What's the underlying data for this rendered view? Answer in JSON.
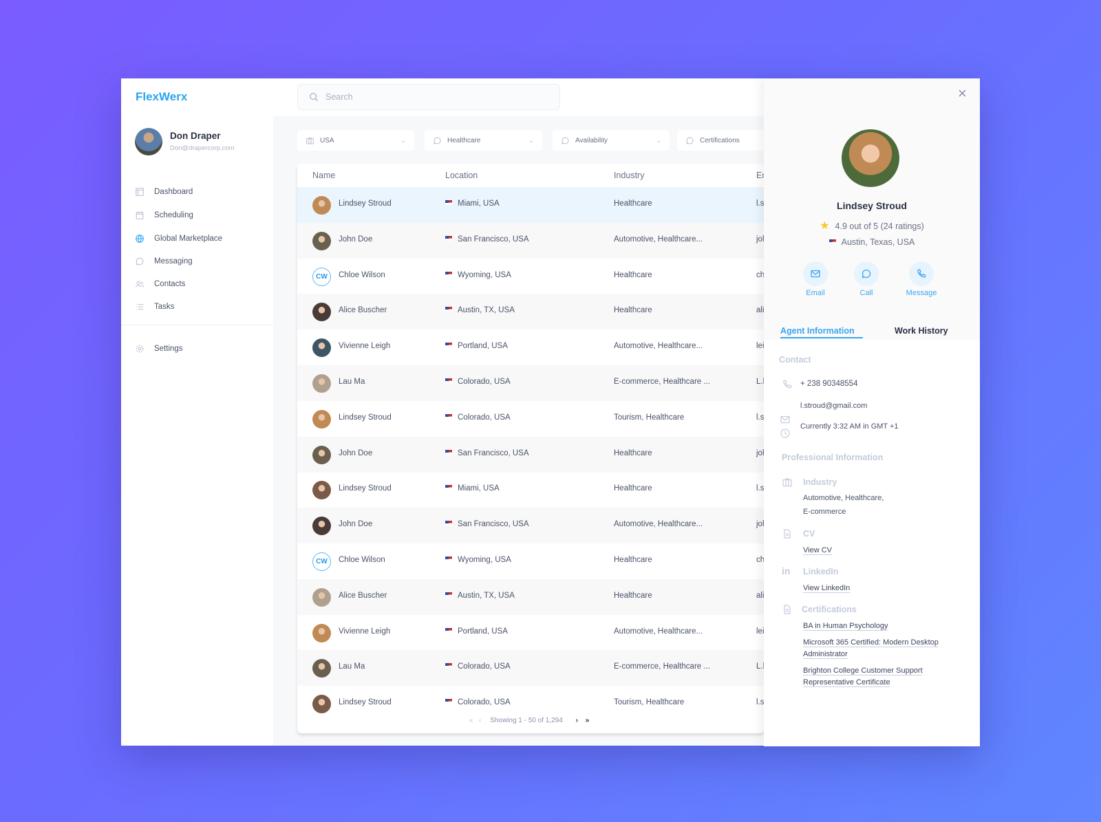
{
  "app": {
    "logo": "FlexWerx"
  },
  "user": {
    "name": "Don Draper",
    "email": "Don@drapercorp.com"
  },
  "sidebar": {
    "items": [
      {
        "label": "Dashboard",
        "icon": "dashboard-icon"
      },
      {
        "label": "Scheduling",
        "icon": "calendar-icon"
      },
      {
        "label": "Global Marketplace",
        "icon": "globe-icon"
      },
      {
        "label": "Messaging",
        "icon": "chat-icon"
      },
      {
        "label": "Contacts",
        "icon": "contacts-icon"
      },
      {
        "label": "Tasks",
        "icon": "list-icon"
      }
    ],
    "settings": "Settings",
    "active_color": "#2aa3f5"
  },
  "search": {
    "placeholder": "Search"
  },
  "filters": [
    "USA",
    "Healthcare",
    "Availability",
    "Certifications"
  ],
  "table": {
    "headers": [
      "Name",
      "Location",
      "Industry",
      "Er"
    ],
    "rows": [
      {
        "name": "Lindsey Stroud",
        "location": "Miami, USA",
        "industry": "Healthcare",
        "email": "l.s"
      },
      {
        "name": "John Doe",
        "location": "San Francisco, USA",
        "industry": "Automotive, Healthcare...",
        "email": "jol"
      },
      {
        "name": "Chloe Wilson",
        "initials": "CW",
        "location": "Wyoming, USA",
        "industry": "Healthcare",
        "email": "ch"
      },
      {
        "name": "Alice Buscher",
        "location": "Austin, TX, USA",
        "industry": "Healthcare",
        "email": "ali"
      },
      {
        "name": "Vivienne Leigh",
        "location": "Portland, USA",
        "industry": "Automotive, Healthcare...",
        "email": "lei"
      },
      {
        "name": "Lau Ma",
        "location": "Colorado, USA",
        "industry": "E-commerce, Healthcare  ...",
        "email": "L.l"
      },
      {
        "name": "Lindsey Stroud",
        "location": "Colorado, USA",
        "industry": "Tourism, Healthcare",
        "email": "l.s"
      },
      {
        "name": "John Doe",
        "location": "San Francisco, USA",
        "industry": "Healthcare",
        "email": "jol"
      },
      {
        "name": "Lindsey Stroud",
        "location": "Miami, USA",
        "industry": "Healthcare",
        "email": "l.s"
      },
      {
        "name": "John Doe",
        "location": "San Francisco, USA",
        "industry": "Automotive, Healthcare...",
        "email": "jol"
      },
      {
        "name": "Chloe Wilson",
        "initials": "CW",
        "location": "Wyoming, USA",
        "industry": "Healthcare",
        "email": "ch"
      },
      {
        "name": "Alice Buscher",
        "location": "Austin, TX, USA",
        "industry": "Healthcare",
        "email": "ali"
      },
      {
        "name": "Vivienne Leigh",
        "location": "Portland, USA",
        "industry": "Automotive, Healthcare...",
        "email": "lei"
      },
      {
        "name": "Lau Ma",
        "location": "Colorado, USA",
        "industry": "E-commerce, Healthcare  ...",
        "email": "L.l"
      },
      {
        "name": "Lindsey Stroud",
        "location": "Colorado, USA",
        "industry": "Tourism, Healthcare",
        "email": "l.s"
      }
    ],
    "pagination": "Showing 1 - 50 of 1,294"
  },
  "panel": {
    "name": "Lindsey Stroud",
    "rating": "4.9 out of 5 (24 ratings)",
    "location": "Austin, Texas, USA",
    "actions": [
      "Email",
      "Call",
      "Message"
    ],
    "tabs": [
      "Agent Information",
      "Work History"
    ],
    "contact_title": "Contact",
    "phone": "+ 238 90348554",
    "email": "l.stroud@gmail.com",
    "time": "Currently 3:32 AM in GMT +1",
    "pro_title": "Professional Information",
    "industry_label": "Industry",
    "industry_lines": [
      "Automotive, Healthcare,",
      "E-commerce"
    ],
    "cv_label": "CV",
    "cv_link": "View CV",
    "linkedin_label": "LinkedIn",
    "linkedin_link": "View LinkedIn",
    "cert_label": "Certifications",
    "certs": [
      "BA in Human Psychology",
      "Microsoft 365 Certified: Modern Desktop Administrator",
      "Brighton College Customer Support Representative Certificate"
    ]
  }
}
